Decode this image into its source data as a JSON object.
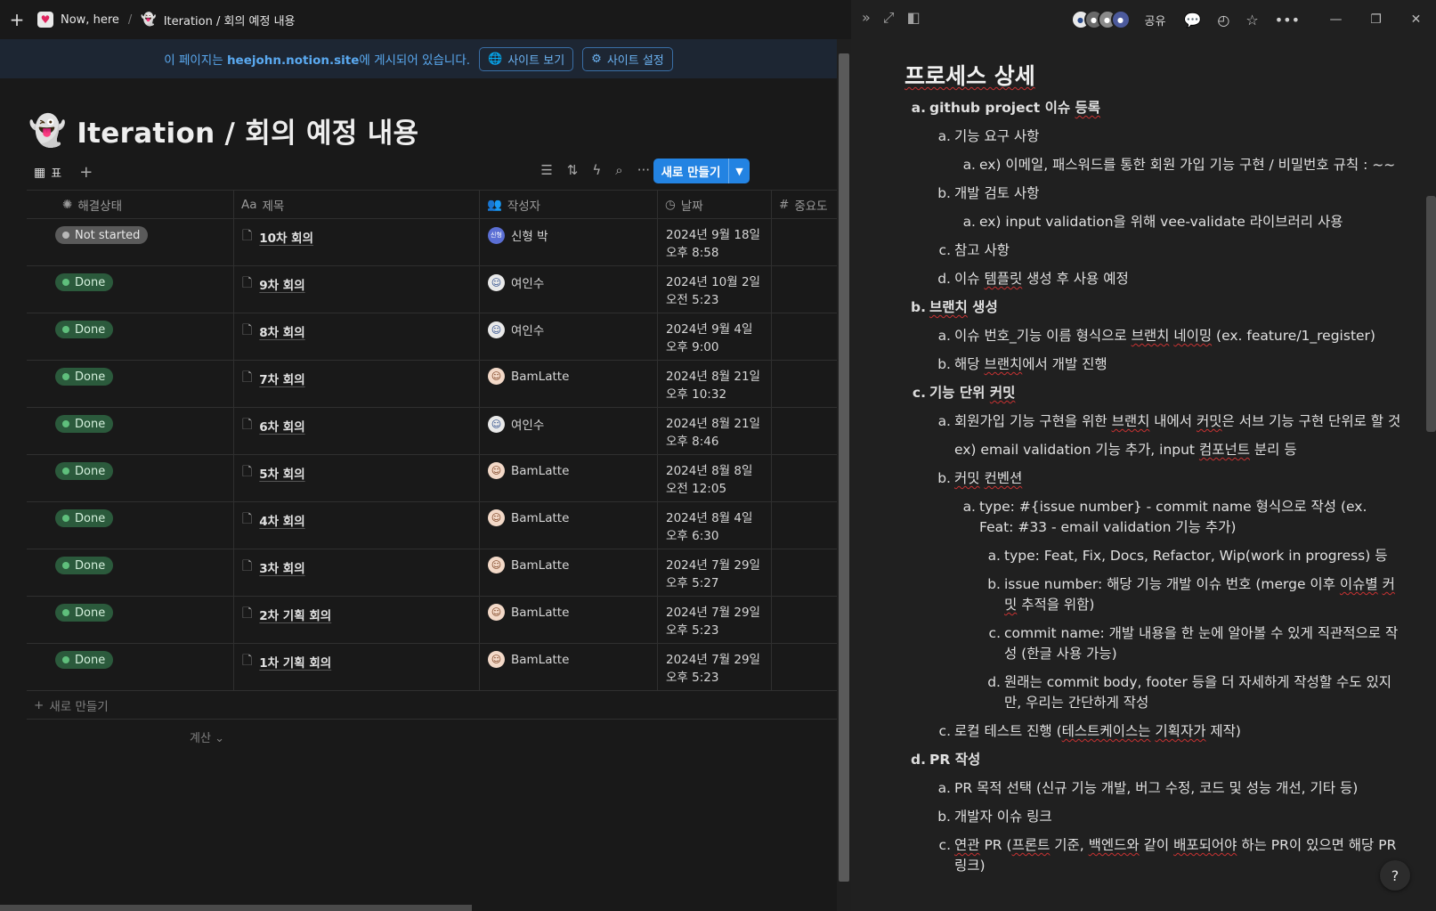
{
  "topbar": {
    "workspace": "Now, here",
    "separator": "/",
    "page": "Iteration / 회의 예정 내용"
  },
  "banner": {
    "message_prefix": "이 페이지는 ",
    "message_site": "heejohn.notion.site",
    "message_suffix": "에 게시되어 있습니다.",
    "view_site": "사이트 보기",
    "site_settings": "사이트 설정"
  },
  "page": {
    "title": "Iteration / 회의 예정 내용"
  },
  "database": {
    "view_label": "표",
    "new_button": "새로 만들기",
    "columns": {
      "status": "해결상태",
      "title": "제목",
      "author": "작성자",
      "date": "날짜",
      "priority": "중요도"
    },
    "rows": [
      {
        "status": "Not started",
        "title": "10차 회의",
        "author": "신형 박",
        "date": "2024년 9월 18일 오후 8:58",
        "avatar": "신형"
      },
      {
        "status": "Done",
        "title": "9차 회의",
        "author": "여인수",
        "date": "2024년 10월 2일 오전 5:23",
        "avatar": "여"
      },
      {
        "status": "Done",
        "title": "8차 회의",
        "author": "여인수",
        "date": "2024년 9월 4일 오후 9:00",
        "avatar": "여"
      },
      {
        "status": "Done",
        "title": "7차 회의",
        "author": "BamLatte",
        "date": "2024년 8월 21일 오후 10:32",
        "avatar": "B"
      },
      {
        "status": "Done",
        "title": "6차 회의",
        "author": "여인수",
        "date": "2024년 8월 21일 오후 8:46",
        "avatar": "여"
      },
      {
        "status": "Done",
        "title": "5차 회의",
        "author": "BamLatte",
        "date": "2024년 8월 8일 오전 12:05",
        "avatar": "B"
      },
      {
        "status": "Done",
        "title": "4차 회의",
        "author": "BamLatte",
        "date": "2024년 8월 4일 오후 6:30",
        "avatar": "B"
      },
      {
        "status": "Done",
        "title": "3차 회의",
        "author": "BamLatte",
        "date": "2024년 7월 29일 오후 5:27",
        "avatar": "B"
      },
      {
        "status": "Done",
        "title": "2차 기획 회의",
        "author": "BamLatte",
        "date": "2024년 7월 29일 오후 5:23",
        "avatar": "B"
      },
      {
        "status": "Done",
        "title": "1차 기획 회의",
        "author": "BamLatte",
        "date": "2024년 7월 29일 오후 5:23",
        "avatar": "B"
      }
    ],
    "new_row": "새로 만들기",
    "calc": "계산"
  },
  "peek": {
    "share": "공유",
    "heading": "프로세스 상세",
    "items": [
      {
        "level": 0,
        "marker": "a.",
        "bold": true,
        "text": "github project 이슈 등록"
      },
      {
        "level": 1,
        "marker": "a.",
        "bold": false,
        "text": "기능 요구 사항"
      },
      {
        "level": 2,
        "marker": "a.",
        "bold": false,
        "text": "ex) 이메일, 패스워드를 통한 회원 가입 기능 구현 / 비밀번호 규칙 : ~~"
      },
      {
        "level": 1,
        "marker": "b.",
        "bold": false,
        "text": "개발 검토 사항"
      },
      {
        "level": 2,
        "marker": "a.",
        "bold": false,
        "text": "ex) input validation을 위해 vee-validate 라이브러리 사용"
      },
      {
        "level": 1,
        "marker": "c.",
        "bold": false,
        "text": "참고 사항"
      },
      {
        "level": 1,
        "marker": "d.",
        "bold": false,
        "text": "이슈 템플릿 생성 후 사용 예정"
      },
      {
        "level": 0,
        "marker": "b.",
        "bold": true,
        "text": "브랜치 생성"
      },
      {
        "level": 1,
        "marker": "a.",
        "bold": false,
        "text": "이슈 번호_기능 이름 형식으로 브랜치 네이밍 (ex. feature/1_register)"
      },
      {
        "level": 1,
        "marker": "b.",
        "bold": false,
        "text": "해당 브랜치에서 개발 진행"
      },
      {
        "level": 0,
        "marker": "c.",
        "bold": true,
        "text": "기능 단위 커밋"
      },
      {
        "level": 1,
        "marker": "a.",
        "bold": false,
        "text": "회원가입 기능 구현을 위한 브랜치 내에서 커밋은 서브 기능 구현 단위로 할 것"
      },
      {
        "level": 1,
        "marker": "",
        "bold": false,
        "text": "ex) email validation 기능 추가, input 컴포넌트 분리 등"
      },
      {
        "level": 1,
        "marker": "b.",
        "bold": false,
        "text": "커밋 컨벤션"
      },
      {
        "level": 2,
        "marker": "a.",
        "bold": false,
        "text": "type: #{issue number} - commit name  형식으로 작성 (ex. Feat: #33 - email validation 기능 추가)"
      },
      {
        "level": 3,
        "marker": "a.",
        "bold": false,
        "text": "type: Feat, Fix, Docs, Refactor, Wip(work in progress) 등"
      },
      {
        "level": 3,
        "marker": "b.",
        "bold": false,
        "text": "issue number:  해당 기능 개발 이슈 번호 (merge 이후 이슈별 커밋 추적을 위함)"
      },
      {
        "level": 3,
        "marker": "c.",
        "bold": false,
        "text": "commit name: 개발 내용을 한 눈에 알아볼 수 있게 직관적으로 작성 (한글 사용 가능)"
      },
      {
        "level": 3,
        "marker": "d.",
        "bold": false,
        "text": "원래는 commit body, footer 등을 더 자세하게 작성할 수도 있지만, 우리는 간단하게 작성"
      },
      {
        "level": 1,
        "marker": "c.",
        "bold": false,
        "text": "로컬 테스트 진행 (테스트케이스는 기획자가 제작)"
      },
      {
        "level": 0,
        "marker": "d.",
        "bold": true,
        "text": "PR 작성"
      },
      {
        "level": 1,
        "marker": "a.",
        "bold": false,
        "text": "PR 목적 선택 (신규 기능 개발, 버그 수정, 코드 및 성능 개선, 기타 등)"
      },
      {
        "level": 1,
        "marker": "b.",
        "bold": false,
        "text": "개발자 이슈 링크"
      },
      {
        "level": 1,
        "marker": "c.",
        "bold": false,
        "text": "연관 PR (프론트 기준, 백엔드와 같이 배포되어야 하는 PR이 있으면 해당 PR 링크)"
      }
    ],
    "help": "?"
  },
  "colors": {
    "accent": "#2383e2",
    "done": "#2b5a3c",
    "not_started": "#5a5a5a",
    "banner_text": "#5aa9f0"
  }
}
